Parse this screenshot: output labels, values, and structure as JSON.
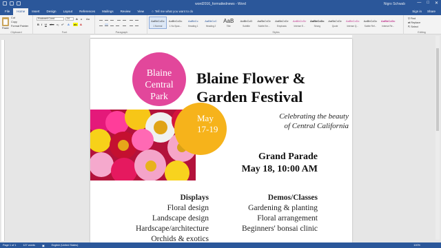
{
  "window": {
    "title": "word2016_formattednews - Word",
    "user": "Nigro Schwab"
  },
  "tabs": [
    "File",
    "Home",
    "Insert",
    "Design",
    "Layout",
    "References",
    "Mailings",
    "Review",
    "View"
  ],
  "active_tab": "Home",
  "tell_me": "Tell me what you want to do",
  "tabs_right": [
    "Sign in",
    "Share"
  ],
  "ribbon": {
    "clipboard": {
      "paste": "Paste",
      "cut": "Cut",
      "copy": "Copy",
      "format_painter": "Format Painter",
      "label": "Clipboard"
    },
    "font": {
      "name": "Rockwell Cond",
      "size": "24",
      "label": "Font"
    },
    "paragraph": {
      "label": "Paragraph"
    },
    "styles": {
      "label": "Styles",
      "items": [
        {
          "sample": "AaBbCcDc",
          "name": "1 Normal"
        },
        {
          "sample": "AaBbCcDc",
          "name": "1 No Spac..."
        },
        {
          "sample": "AaBbCc",
          "name": "Heading 1"
        },
        {
          "sample": "AaBbCcC",
          "name": "Heading 2"
        },
        {
          "sample": "AaB",
          "name": "Title"
        },
        {
          "sample": "AaBbCcD",
          "name": "Subtitle"
        },
        {
          "sample": "AaBbCcDc",
          "name": "Subtle Em..."
        },
        {
          "sample": "AaBbCcDc",
          "name": "Emphasis"
        },
        {
          "sample": "AaBbCcDc",
          "name": "Intense E..."
        },
        {
          "sample": "AaBbCcDc",
          "name": "Strong"
        },
        {
          "sample": "AaBbCcDc",
          "name": "Quote"
        },
        {
          "sample": "AaBbCcDc",
          "name": "Intense Q..."
        },
        {
          "sample": "AaBbCcDc",
          "name": "Subtle Ref..."
        },
        {
          "sample": "AaBbCcDc",
          "name": "Intense Re..."
        },
        {
          "sample": "AaBbCcDc",
          "name": "Book Title"
        }
      ]
    },
    "editing": {
      "find": "Find",
      "replace": "Replace",
      "select": "Select",
      "label": "Editing"
    }
  },
  "flyer": {
    "circle_pink_lines": [
      "Blaine",
      "Central",
      "Park"
    ],
    "circle_yellow_lines": [
      "May",
      "17-19"
    ],
    "title_lines": [
      "Blaine Flower &",
      "Garden Festival"
    ],
    "tagline_lines": [
      "Celebrating the beauty",
      "of Central California"
    ],
    "parade_title": "Grand Parade",
    "parade_date": "May 18, 10:00 AM",
    "displays": {
      "heading": "Displays",
      "items": [
        "Floral design",
        "Landscape design",
        "Hardscape/architecture",
        "Orchids & exotics"
      ]
    },
    "demos": {
      "heading": "Demos/Classes",
      "items": [
        "Gardening & planting",
        "Floral arrangement",
        "Beginners' bonsai clinic"
      ]
    }
  },
  "status": {
    "page": "Page 1 of 1",
    "words": "127 words",
    "language": "English (United States)",
    "zoom": "100%"
  },
  "colors": {
    "accent": "#2b579a",
    "pink": "#e2479b",
    "yellow": "#f6b31b"
  }
}
